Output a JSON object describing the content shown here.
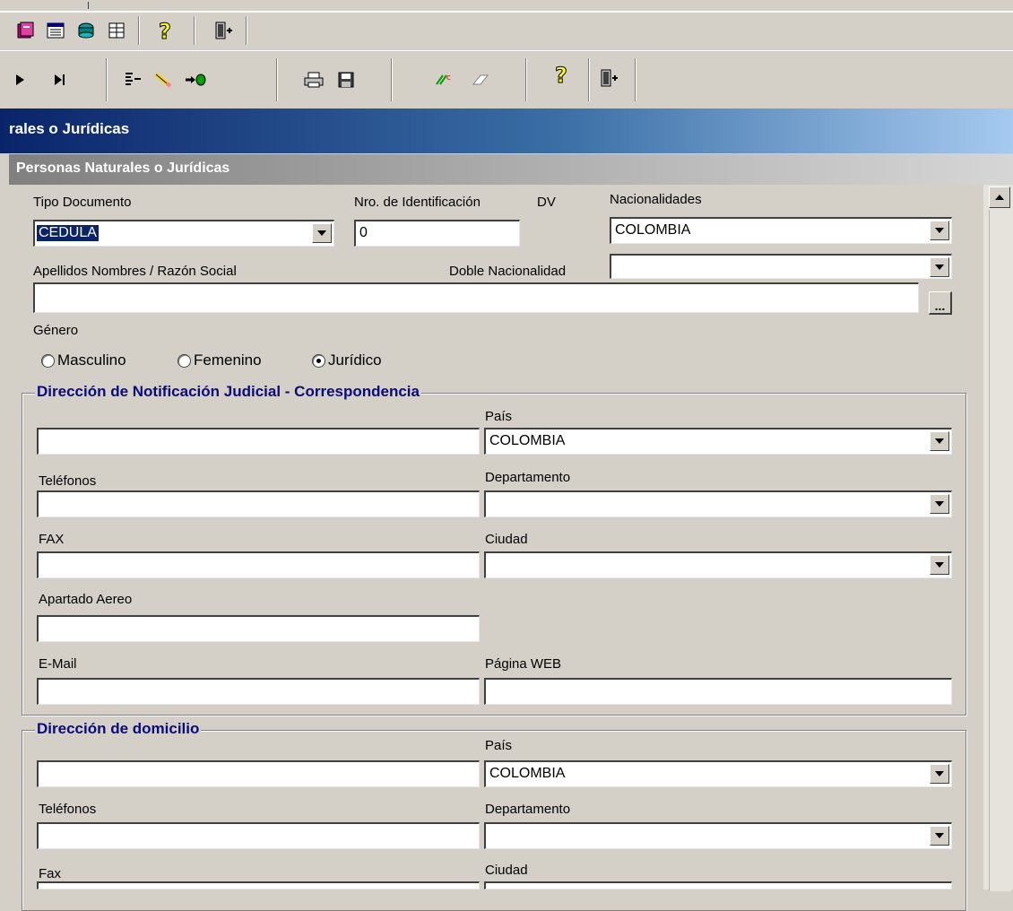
{
  "toolbar1": {
    "icons": [
      "book-icon",
      "calendar-icon",
      "stack-icon",
      "grid-icon",
      "help-icon",
      "exit-door-icon"
    ]
  },
  "toolbar2": {
    "icons": [
      "play-icon",
      "skip-end-icon",
      "list-icon",
      "eraser-pen-icon",
      "arrow-right-icon",
      "printer-icon",
      "save-icon",
      "spellcheck-icon",
      "eraser-icon",
      "help-icon",
      "exit-door-icon"
    ]
  },
  "window": {
    "title": "rales o Jurídicas",
    "subtitle": "Personas Naturales o Jurídicas"
  },
  "form": {
    "tipo_documento": {
      "label": "Tipo Documento",
      "value": "CEDULA"
    },
    "nro_identificacion": {
      "label": "Nro. de Identificación",
      "value": "0"
    },
    "dv": {
      "label": "DV"
    },
    "nacionalidades": {
      "label": "Nacionalidades",
      "value": "COLOMBIA"
    },
    "apellidos": {
      "label": "Apellidos Nombres / Razón Social",
      "value": ""
    },
    "doble_nacionalidad": {
      "label": "Doble Nacionalidad",
      "value": ""
    },
    "lookup_label": "...",
    "genero": {
      "label": "Género",
      "options": [
        "Masculino",
        "Femenino",
        "Jurídico"
      ],
      "selected": "Jurídico"
    }
  },
  "notificacion": {
    "title": "Dirección de Notificación Judicial - Correspondencia",
    "pais_label": "País",
    "pais_value": "COLOMBIA",
    "telefonos_label": "Teléfonos",
    "departamento_label": "Departamento",
    "fax_label": "FAX",
    "ciudad_label": "Ciudad",
    "apartado_label": "Apartado Aereo",
    "email_label": "E-Mail",
    "web_label": "Página WEB"
  },
  "domicilio": {
    "title": "Dirección de domicilio",
    "pais_label": "País",
    "pais_value": "COLOMBIA",
    "telefonos_label": "Teléfonos",
    "departamento_label": "Departamento",
    "fax_label": "Fax",
    "ciudad_label": "Ciudad"
  }
}
